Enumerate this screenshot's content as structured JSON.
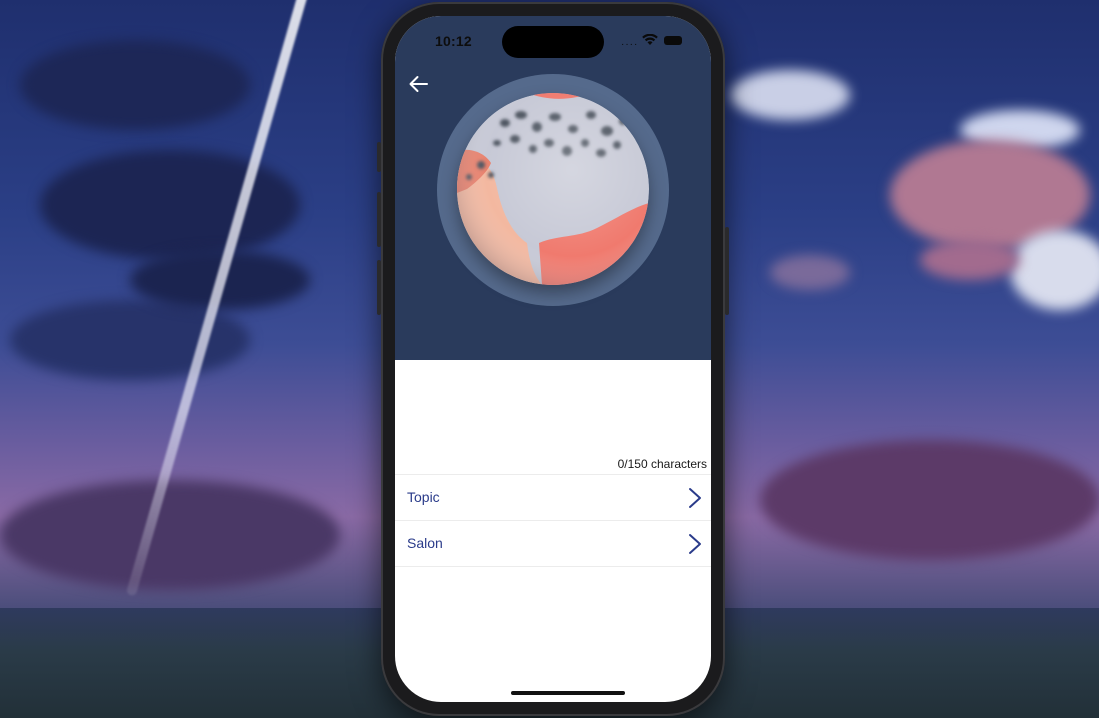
{
  "status_bar": {
    "time": "10:12"
  },
  "nav": {
    "back_icon": "arrow-left-icon"
  },
  "orb": {
    "icon": "planet-orb-image"
  },
  "composer": {
    "value": "",
    "char_count": "0/150 characters"
  },
  "options": [
    {
      "label": "Topic",
      "icon": "chevron-right-icon"
    },
    {
      "label": "Salon",
      "icon": "chevron-right-icon"
    }
  ],
  "colors": {
    "hero_bg": "#2a3b5c",
    "row_text": "#2a3b8a",
    "orb_grey": "#c9cbd8",
    "orb_salmon": "#f07a6e"
  }
}
